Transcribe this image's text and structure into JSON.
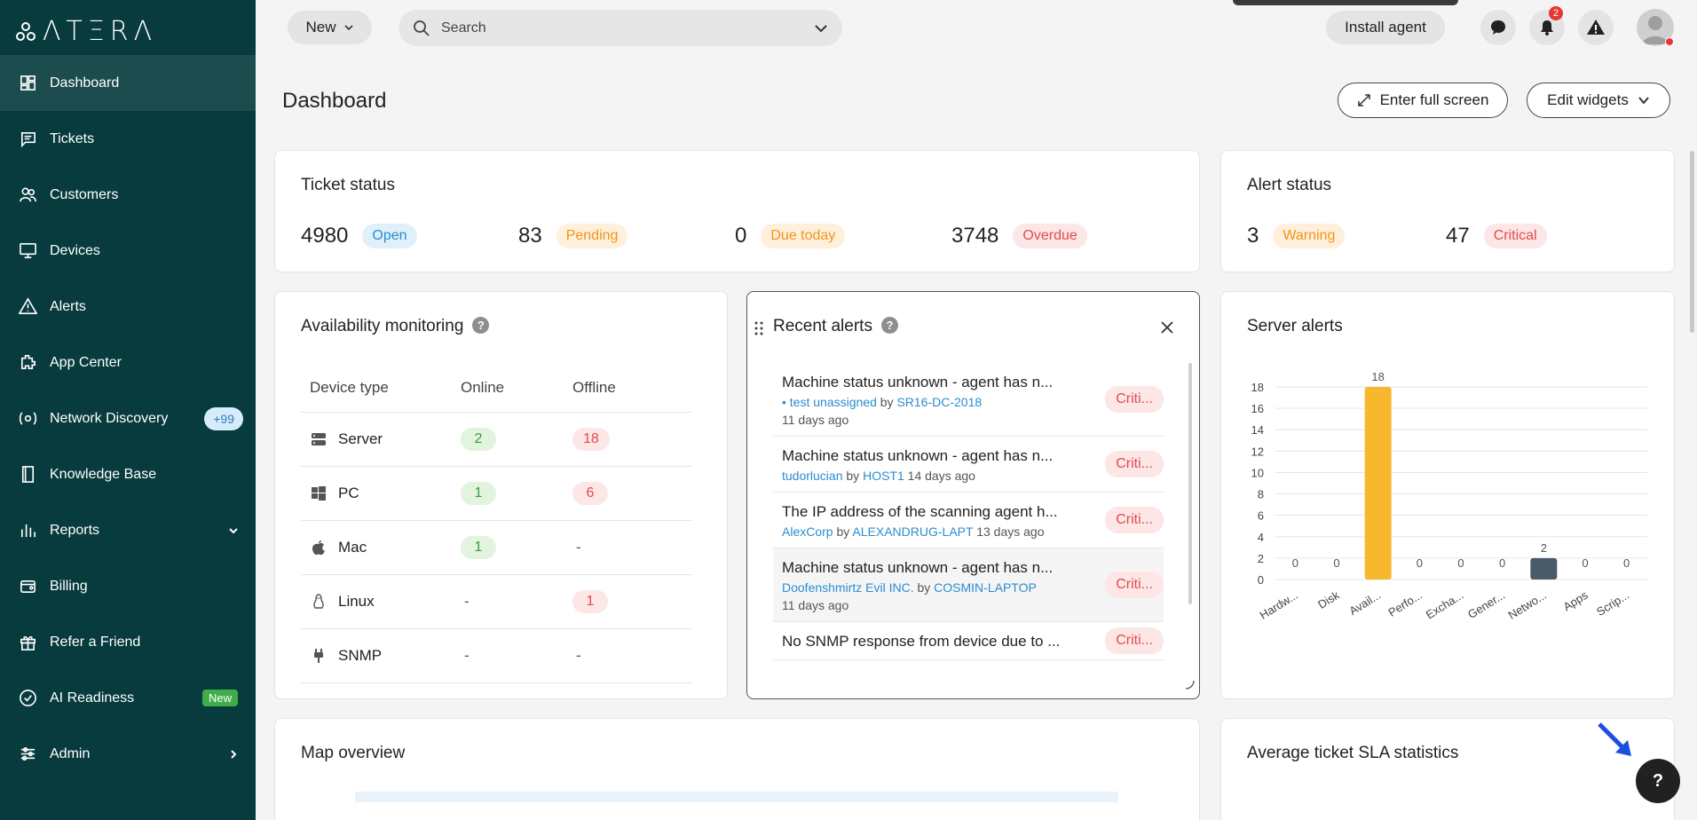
{
  "brand": {
    "logo_text": "ΛΤΞRΛ"
  },
  "sidebar": {
    "items": [
      {
        "label": "Dashboard",
        "icon": "dashboard-icon",
        "active": true
      },
      {
        "label": "Tickets",
        "icon": "tickets-icon"
      },
      {
        "label": "Customers",
        "icon": "customers-icon"
      },
      {
        "label": "Devices",
        "icon": "devices-icon"
      },
      {
        "label": "Alerts",
        "icon": "alerts-icon"
      },
      {
        "label": "App Center",
        "icon": "app-center-icon"
      },
      {
        "label": "Network Discovery",
        "icon": "network-discovery-icon",
        "badge": "+99"
      },
      {
        "label": "Knowledge Base",
        "icon": "knowledge-base-icon"
      },
      {
        "label": "Reports",
        "icon": "reports-icon"
      },
      {
        "label": "Billing",
        "icon": "billing-icon"
      },
      {
        "label": "Refer a Friend",
        "icon": "gift-icon"
      },
      {
        "label": "AI Readiness",
        "icon": "ai-readiness-icon",
        "badge": "New"
      },
      {
        "label": "Admin",
        "icon": "admin-icon"
      }
    ]
  },
  "topbar": {
    "new_label": "New",
    "search_placeholder": "Search",
    "install_label": "Install agent",
    "notification_count": "2"
  },
  "page": {
    "title": "Dashboard",
    "fullscreen_label": "Enter full screen",
    "edit_widgets_label": "Edit widgets"
  },
  "ticket_status": {
    "title": "Ticket status",
    "stats": [
      {
        "value": "4980",
        "label": "Open"
      },
      {
        "value": "83",
        "label": "Pending"
      },
      {
        "value": "0",
        "label": "Due today"
      },
      {
        "value": "3748",
        "label": "Overdue"
      }
    ]
  },
  "alert_status": {
    "title": "Alert status",
    "stats": [
      {
        "value": "3",
        "label": "Warning"
      },
      {
        "value": "47",
        "label": "Critical"
      }
    ]
  },
  "availability": {
    "title": "Availability monitoring",
    "headers": [
      "Device type",
      "Online",
      "Offline"
    ],
    "rows": [
      {
        "type": "Server",
        "online": "2",
        "offline": "18"
      },
      {
        "type": "PC",
        "online": "1",
        "offline": "6"
      },
      {
        "type": "Mac",
        "online": "1",
        "offline": "-"
      },
      {
        "type": "Linux",
        "online": "-",
        "offline": "1"
      },
      {
        "type": "SNMP",
        "online": "-",
        "offline": "-"
      }
    ]
  },
  "recent_alerts": {
    "title": "Recent alerts",
    "items": [
      {
        "title": "Machine status unknown - agent has n...",
        "customer": "• test unassigned",
        "by": "by",
        "device": "SR16-DC-2018",
        "time": "11 days ago",
        "severity": "Criti..."
      },
      {
        "title": "Machine status unknown - agent has n...",
        "customer": "tudorlucian",
        "by": "by",
        "device": "HOST1",
        "time": "14 days ago",
        "severity": "Criti..."
      },
      {
        "title": "The IP address of the scanning agent h...",
        "customer": "AlexCorp",
        "by": "by",
        "device": "ALEXANDRUG-LAPT",
        "time": "13 days ago",
        "severity": "Criti..."
      },
      {
        "title": "Machine status unknown - agent has n...",
        "customer": "Doofenshmirtz Evil INC.",
        "by": "by",
        "device": "COSMIN-LAPTOP",
        "time": "11 days ago",
        "severity": "Criti..."
      },
      {
        "title": "No SNMP response from device due to ...",
        "customer": "",
        "by": "",
        "device": "",
        "time": "",
        "severity": "Criti..."
      }
    ]
  },
  "server_alerts": {
    "title": "Server alerts"
  },
  "chart_data": {
    "type": "bar",
    "title": "Server alerts",
    "categories": [
      "Hardw...",
      "Disk",
      "Avail...",
      "Perfo...",
      "Excha...",
      "Gener...",
      "Netwo...",
      "Apps",
      "Scrip..."
    ],
    "values": [
      0,
      0,
      18,
      0,
      0,
      0,
      2,
      0,
      0
    ],
    "colors": [
      "#f7b82e",
      "#f7b82e",
      "#f7b82e",
      "#f7b82e",
      "#f7b82e",
      "#f7b82e",
      "#4a5a68",
      "#f7b82e",
      "#f7b82e"
    ],
    "yticks": [
      0,
      2,
      4,
      6,
      8,
      10,
      12,
      14,
      16,
      18
    ],
    "ylim": [
      0,
      18
    ],
    "grid": true
  },
  "map_overview": {
    "title": "Map overview"
  },
  "sla_stats": {
    "title": "Average ticket SLA statistics"
  },
  "help": {
    "label": "?"
  },
  "colors": {
    "sidebar": "#083b3d",
    "accent_blue": "#2b8dd0",
    "critical": "#e04c4c",
    "warning": "#f0941a"
  }
}
